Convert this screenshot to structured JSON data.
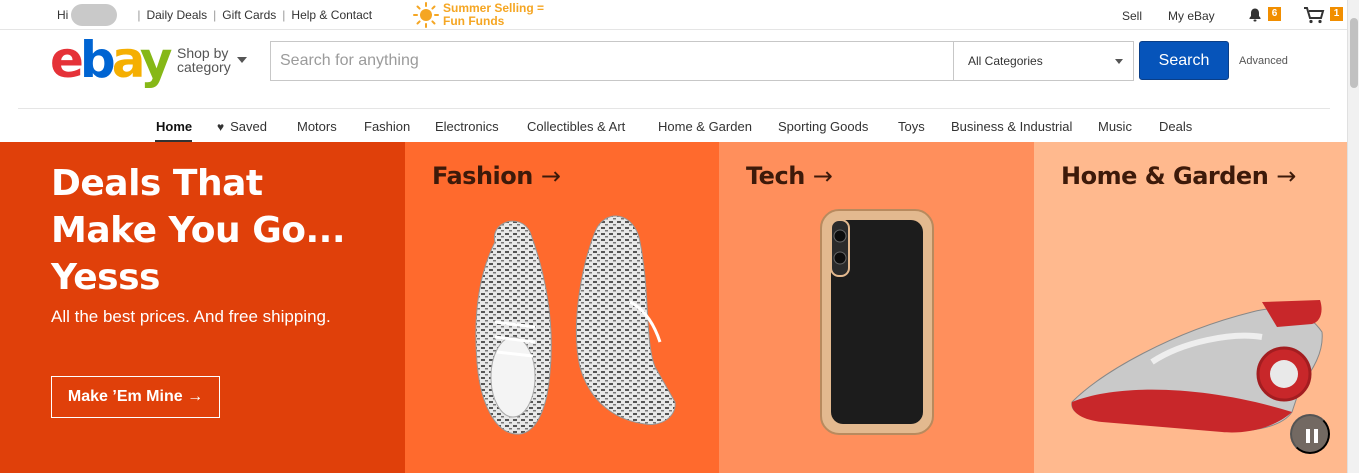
{
  "topbar": {
    "greeting": "Hi",
    "links": [
      "Daily Deals",
      "Gift Cards",
      "Help & Contact"
    ],
    "promo_line1": "Summer Selling =",
    "promo_line2": "Fun Funds",
    "sell": "Sell",
    "my_ebay": "My eBay",
    "notifications_count": "6",
    "cart_count": "1"
  },
  "header": {
    "logo": {
      "e": "e",
      "b": "b",
      "a": "a",
      "y": "y"
    },
    "shop_by_line1": "Shop by",
    "shop_by_line2": "category",
    "search_placeholder": "Search for anything",
    "category_selected": "All Categories",
    "search_button": "Search",
    "advanced": "Advanced"
  },
  "nav": {
    "items": [
      "Home",
      "Saved",
      "Motors",
      "Fashion",
      "Electronics",
      "Collectibles & Art",
      "Home & Garden",
      "Sporting Goods",
      "Toys",
      "Business & Industrial",
      "Music",
      "Deals"
    ],
    "active": "Home"
  },
  "banner": {
    "headline_line1": "Deals That",
    "headline_line2": "Make You Go...",
    "headline_line3": "Yesss",
    "subline": "All the best prices. And free shipping.",
    "cta": "Make ’Em Mine →",
    "panels": [
      {
        "title": "Fashion",
        "arrow": "→"
      },
      {
        "title": "Tech",
        "arrow": "→"
      },
      {
        "title": "Home & Garden",
        "arrow": "→"
      }
    ]
  },
  "colors": {
    "deals_panel": "#e0400a",
    "fashion_panel": "#ff6a2d",
    "tech_panel": "#ff8f5c",
    "home_panel": "#ffb98e",
    "search_button": "#0654ba",
    "badge": "#f18e00"
  }
}
